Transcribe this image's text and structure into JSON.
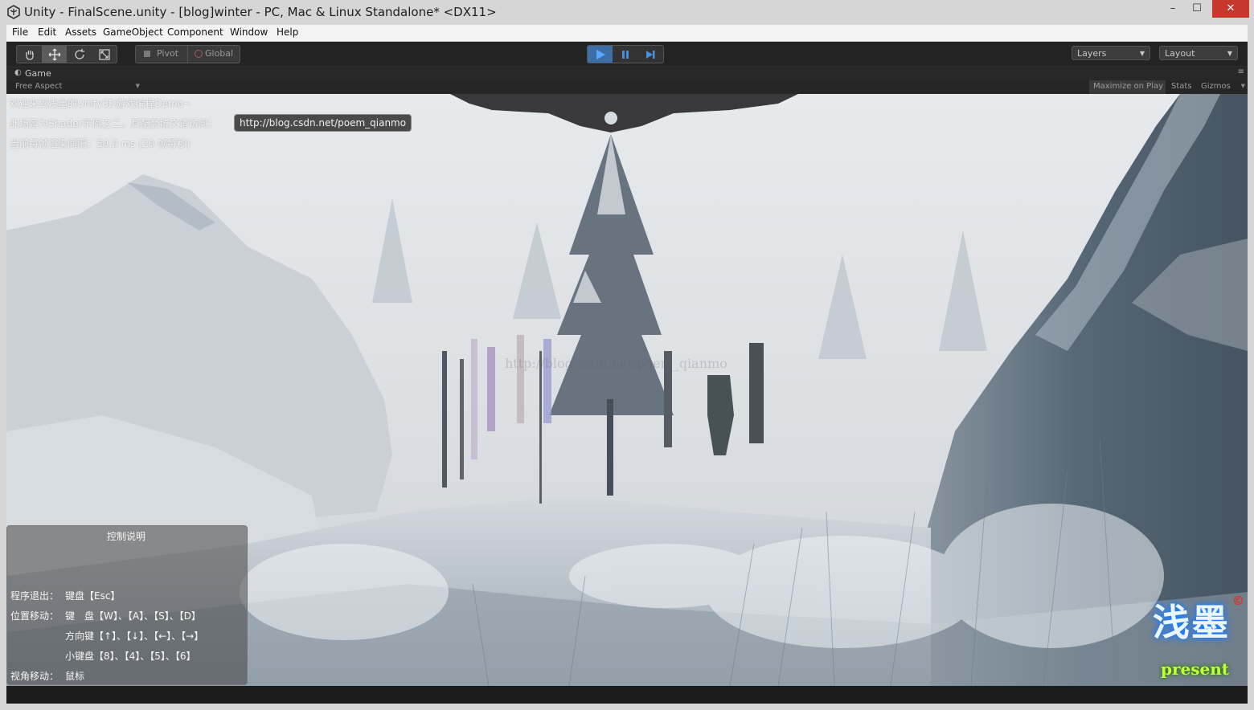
{
  "window": {
    "title": "Unity - FinalScene.unity - [blog]winter - PC, Mac & Linux Standalone* <DX11>",
    "minimize_glyph": "–",
    "maximize_glyph": "☐",
    "close_glyph": "✕"
  },
  "menu": [
    "File",
    "Edit",
    "Assets",
    "GameObject",
    "Component",
    "Window",
    "Help"
  ],
  "toolbar": {
    "pivot_label": "Pivot",
    "global_label": "Global",
    "layers_label": "Layers",
    "layout_label": "Layout"
  },
  "game_view": {
    "tab_label": "Game",
    "aspect_label": "Free Aspect",
    "maximize_label": "Maximize on Play",
    "stats_label": "Stats",
    "gizmos_label": "Gizmos"
  },
  "overlay": {
    "welcome": "欢迎来到浅墨的Unity3D游戏编程Demo~",
    "shader_intro": "此场景为Shader示例之二，其配套博文请访问：",
    "blog_url": "http://blog.csdn.net/poem_qianmo",
    "frame_time": "当前每帧渲染间隔：50.0 ms (20 帧每秒)",
    "watermark": "http://blog.csdn.net/poem_qianmo"
  },
  "controls": {
    "title": "控制说明",
    "quit_label": "程序退出：",
    "quit_value": "键盘【Esc】",
    "move_label": "位置移动：",
    "move_keys": "键　盘【W】、【A】、【S】、【D】",
    "arrow_keys": "方向键【↑】、【↓】、【←】、【→】",
    "numpad_keys": "小键盘【8】、【4】、【5】、【6】",
    "view_label": "视角移动：",
    "view_value": "鼠标"
  },
  "logo": {
    "name": "浅墨",
    "tagline": "present",
    "copyright": "©"
  },
  "colors": {
    "play_active": "#4a8fd8",
    "close_button": "#c7372b"
  }
}
